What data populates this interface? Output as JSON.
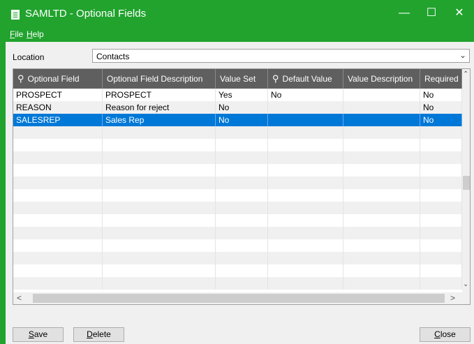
{
  "window": {
    "title": "SAMLTD - Optional Fields",
    "controls": {
      "minimize": "—",
      "maximize": "☐",
      "close": "✕"
    }
  },
  "menu": {
    "file": {
      "ul": "F",
      "rest": "ile"
    },
    "help": {
      "ul": "H",
      "rest": "elp"
    }
  },
  "location": {
    "label": "Location",
    "value": "Contacts"
  },
  "grid": {
    "columns": [
      "Optional Field",
      "Optional Field Description",
      "Value Set",
      "Default Value",
      "Value Description",
      "Required"
    ],
    "rows": [
      [
        "PROSPECT",
        "PROSPECT",
        "Yes",
        "No",
        "",
        "No"
      ],
      [
        "REASON",
        "Reason for reject",
        "No",
        "",
        "",
        "No"
      ],
      [
        "SALESREP",
        "Sales Rep",
        "No",
        "",
        "",
        "No"
      ]
    ],
    "selected_row": 2
  },
  "buttons": {
    "save": {
      "ul": "S",
      "rest": "ave"
    },
    "delete": {
      "ul": "D",
      "rest": "elete"
    },
    "close": {
      "ul": "C",
      "rest": "lose"
    }
  },
  "colors": {
    "titlebar": "#21a32e",
    "header": "#5f5f5f",
    "selected": "#0078d7"
  }
}
